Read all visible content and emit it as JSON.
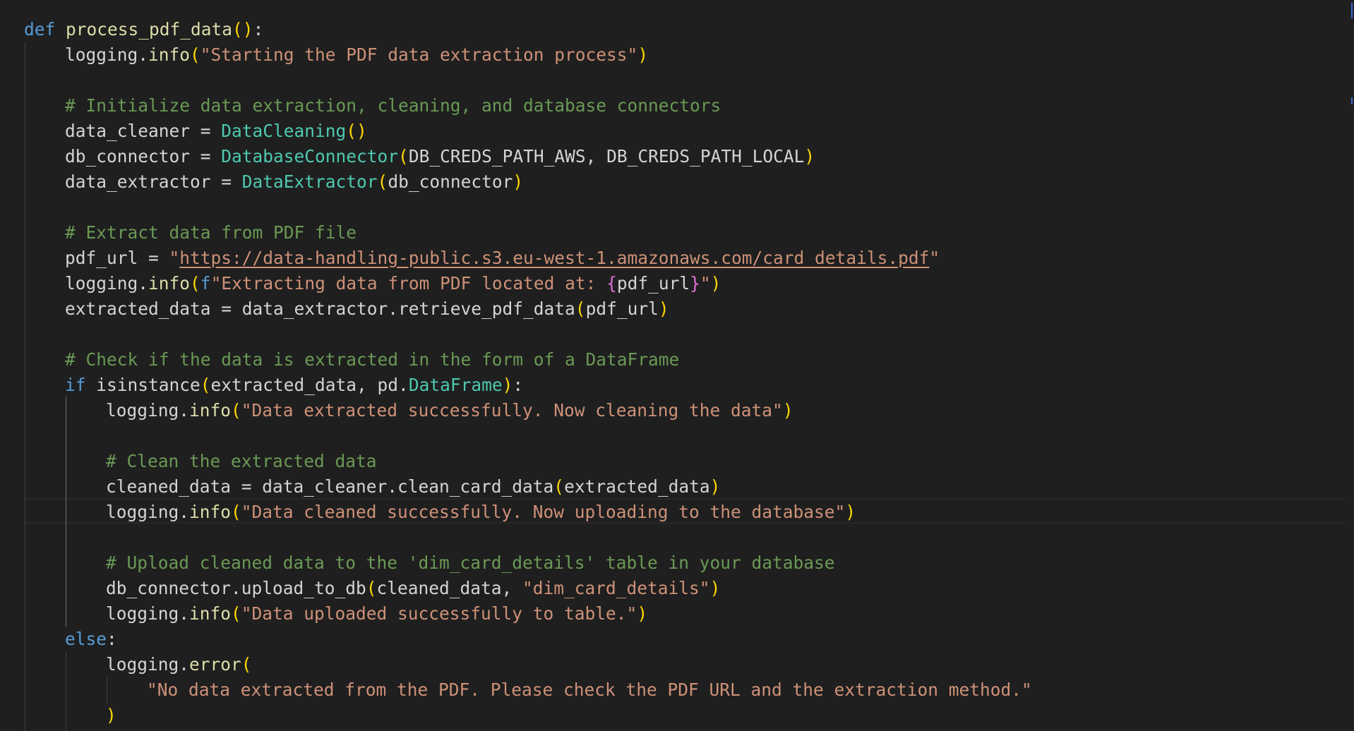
{
  "editor": {
    "language": "python",
    "theme_colors": {
      "background": "#1f1f1f",
      "keyword": "#569cd6",
      "control_keyword": "#c586c0",
      "function": "#dcdcaa",
      "class": "#4ec9b0",
      "string": "#ce9178",
      "comment": "#6a9955",
      "variable": "#9cdcfe",
      "bracket_level1": "#ffd700",
      "bracket_level2": "#da70d6"
    },
    "current_line": 20
  },
  "code": {
    "l1_def": "def",
    "l1_fn": "process_pdf_data",
    "l1_paren": "()",
    "l1_colon": ":",
    "l2_obj": "logging.",
    "l2_fn": "info",
    "l2_open": "(",
    "l2_str": "\"Starting the PDF data extraction process\"",
    "l2_close": ")",
    "l4_comment": "# Initialize data extraction, cleaning, and database connectors",
    "l5_var": "data_cleaner",
    "l5_eq": " = ",
    "l5_cls": "DataCleaning",
    "l5_paren": "()",
    "l6_var": "db_connector",
    "l6_eq": " = ",
    "l6_cls": "DatabaseConnector",
    "l6_open": "(",
    "l6_args": "DB_CREDS_PATH_AWS, DB_CREDS_PATH_LOCAL",
    "l6_close": ")",
    "l7_var": "data_extractor",
    "l7_eq": " = ",
    "l7_cls": "DataExtractor",
    "l7_open": "(",
    "l7_args": "db_connector",
    "l7_close": ")",
    "l9_comment": "# Extract data from PDF file",
    "l10_var": "pdf_url",
    "l10_eq": " = ",
    "l10_q1": "\"",
    "l10_url": "https://data-handling-public.s3.eu-west-1.amazonaws.com/card_details.pdf",
    "l10_q2": "\"",
    "l11_obj": "logging.",
    "l11_fn": "info",
    "l11_open": "(",
    "l11_prefix": "f",
    "l11_str": "\"Extracting data from PDF located at: ",
    "l11_lbrace": "{",
    "l11_interp": "pdf_url",
    "l11_rbrace": "}",
    "l11_strend": "\"",
    "l11_close": ")",
    "l12_var": "extracted_data",
    "l12_eq": " = ",
    "l12_call": "data_extractor.retrieve_pdf_data",
    "l12_open": "(",
    "l12_args": "pdf_url",
    "l12_close": ")",
    "l14_comment": "# Check if the data is extracted in the form of a DataFrame",
    "l15_if": "if",
    "l15_fn": " isinstance",
    "l15_open": "(",
    "l15_args": "extracted_data, pd.",
    "l15_cls": "DataFrame",
    "l15_close": ")",
    "l15_colon": ":",
    "l16_obj": "logging.",
    "l16_fn": "info",
    "l16_open": "(",
    "l16_str": "\"Data extracted successfully. Now cleaning the data\"",
    "l16_close": ")",
    "l18_comment": "# Clean the extracted data",
    "l19_var": "cleaned_data",
    "l19_eq": " = ",
    "l19_call": "data_cleaner.clean_card_data",
    "l19_open": "(",
    "l19_args": "extracted_data",
    "l19_close": ")",
    "l20_obj": "logging.",
    "l20_fn": "info",
    "l20_open": "(",
    "l20_str": "\"Data cleaned successfully. Now uploading to the database\"",
    "l20_close": ")",
    "l22_comment": "# Upload cleaned data to the 'dim_card_details' table in your database",
    "l23_call": "db_connector.upload_to_db",
    "l23_open": "(",
    "l23_args": "cleaned_data, ",
    "l23_str": "\"dim_card_details\"",
    "l23_close": ")",
    "l24_obj": "logging.",
    "l24_fn": "info",
    "l24_open": "(",
    "l24_str": "\"Data uploaded successfully to table.\"",
    "l24_close": ")",
    "l25_else": "else",
    "l25_colon": ":",
    "l26_obj": "logging.",
    "l26_fn": "error",
    "l26_open": "(",
    "l27_str": "\"No data extracted from the PDF. Please check the PDF URL and the extraction method.\"",
    "l28_close": ")"
  }
}
